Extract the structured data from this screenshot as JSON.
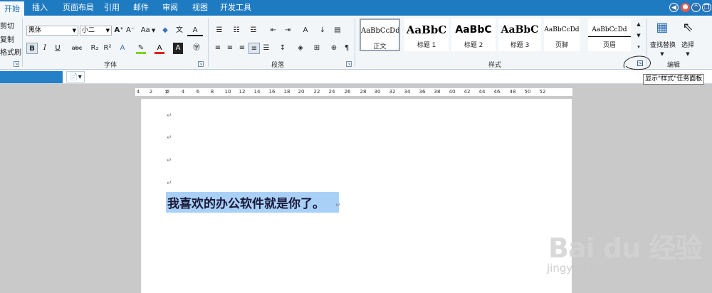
{
  "menu": {
    "tabs": [
      "开始",
      "插入",
      "页面布局",
      "引用",
      "邮件",
      "审阅",
      "视图",
      "开发工具"
    ],
    "active": "开始"
  },
  "clipboard": {
    "cut": "剪切",
    "copy": "复制",
    "format_painter": "格式刷"
  },
  "font": {
    "name": "黑体",
    "size": "小二",
    "group_label": "字体",
    "grow": "A⁺",
    "shrink": "A⁻",
    "change_case": "Aa",
    "bold": "B",
    "italic": "I",
    "underline": "U",
    "strike": "abc",
    "subscript": "R₂",
    "superscript": "R²"
  },
  "paragraph": {
    "group_label": "段落",
    "show_marks": "¶"
  },
  "styles": {
    "group_label": "样式",
    "items": [
      {
        "preview": "AaBbCcDd",
        "name": "正文"
      },
      {
        "preview": "AaBbC",
        "name": "标题 1"
      },
      {
        "preview": "AaBbC",
        "name": "标题 2"
      },
      {
        "preview": "AaBbC",
        "name": "标题 3"
      },
      {
        "preview": "AaBbCcDd",
        "name": "页脚"
      },
      {
        "preview": "AaBbCcDd",
        "name": "页眉"
      }
    ]
  },
  "editing": {
    "group_label": "编辑",
    "find_replace": "查找替换",
    "select": "选择"
  },
  "tooltip": "显示\"样式\"任务面板",
  "ruler": [
    "4",
    "2",
    "2",
    "4",
    "6",
    "8",
    "10",
    "12",
    "14",
    "16",
    "18",
    "20",
    "22",
    "24",
    "26",
    "28",
    "30",
    "32",
    "34",
    "36",
    "38",
    "40",
    "42",
    "44",
    "46",
    "48",
    "50",
    "52"
  ],
  "document": {
    "paragraph_mark": "↵",
    "text": "我喜欢的办公软件就是你了。"
  },
  "watermark": {
    "brand": "Bai du 经验",
    "url": "jingyan.baidu.com"
  },
  "colors": {
    "accent": "#1f7bc1",
    "selection": "#a9d1f7",
    "ribbon_bg": "#f3f6f9"
  }
}
